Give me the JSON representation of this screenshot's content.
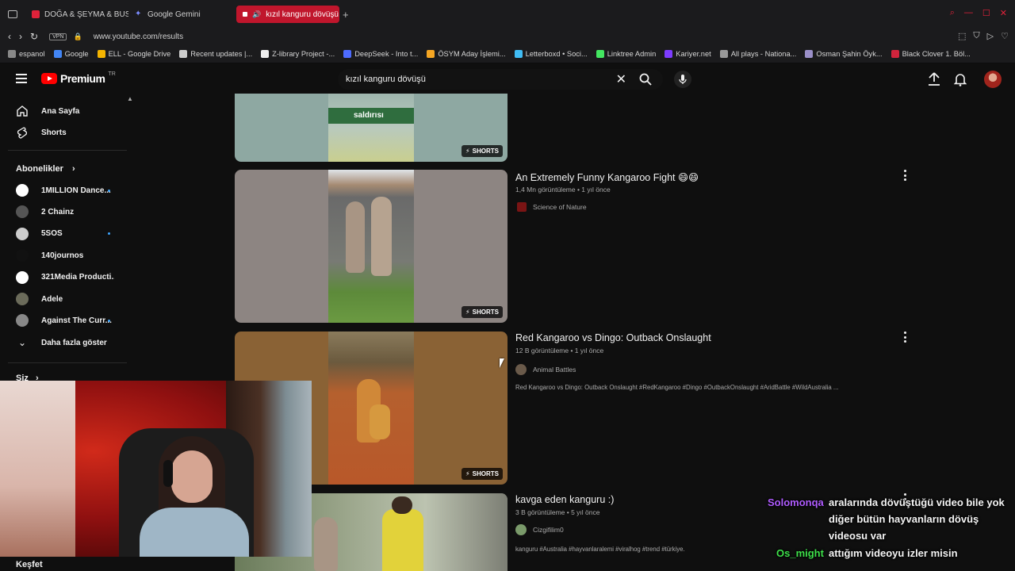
{
  "browser": {
    "tabs": [
      {
        "label": "DOĞA & ŞEYMA & BUSE &",
        "color": "#e0223a"
      },
      {
        "label": "Google Gemini",
        "color": "#7b8cff"
      },
      {
        "label": "kızıl kanguru dövüşü -",
        "color": "#ffffff",
        "active": true
      }
    ],
    "vpn_label": "VPN",
    "url": "www.youtube.com/results",
    "bookmarks": [
      {
        "label": "espanol",
        "color": "#888888"
      },
      {
        "label": "Google",
        "color": "#4285f4"
      },
      {
        "label": "ELL - Google Drive",
        "color": "#f4b400"
      },
      {
        "label": "Recent updates |...",
        "color": "#cccccc"
      },
      {
        "label": "Z-library Project -...",
        "color": "#eeeeee"
      },
      {
        "label": "DeepSeek - Into t...",
        "color": "#4d6bfe"
      },
      {
        "label": "ÖSYM Aday İşlemi...",
        "color": "#f5a623"
      },
      {
        "label": "Letterboxd • Soci...",
        "color": "#40bcf4"
      },
      {
        "label": "Linktree Admin",
        "color": "#43e660"
      },
      {
        "label": "Kariyer.net",
        "color": "#7d3cff"
      },
      {
        "label": "All plays - Nationa...",
        "color": "#999999"
      },
      {
        "label": "Osman Şahin Öyk...",
        "color": "#9a8fc8"
      },
      {
        "label": "Black Clover 1. Böl...",
        "color": "#d0243c"
      }
    ]
  },
  "youtube": {
    "logo_text": "Premium",
    "logo_region": "TR",
    "search_query": "kızıl kanguru dövüşü"
  },
  "sidebar": {
    "main_items": [
      {
        "label": "Ana Sayfa",
        "icon": "home-icon"
      },
      {
        "label": "Shorts",
        "icon": "shorts-icon"
      }
    ],
    "subscriptions_header": "Abonelikler",
    "subscriptions": [
      {
        "label": "1MILLION Dance...",
        "color": "#ffffff",
        "new": true
      },
      {
        "label": "2 Chainz",
        "color": "#555555",
        "new": false
      },
      {
        "label": "5SOS",
        "color": "#cccccc",
        "new": true
      },
      {
        "label": "140journos",
        "color": "#111111",
        "new": false
      },
      {
        "label": "321Media Producti...",
        "color": "#ffffff",
        "new": false
      },
      {
        "label": "Adele",
        "color": "#6b6b5a",
        "new": false
      },
      {
        "label": "Against The Curr...",
        "color": "#888888",
        "new": true
      }
    ],
    "show_more": "Daha fazla göster",
    "you_header": "Siz",
    "explore_header": "Keşfet"
  },
  "results": [
    {
      "title": "",
      "caption": "saldırısı",
      "badge": "SHORTS"
    },
    {
      "title": "An Extremely Funny Kangaroo Fight 😄😄",
      "meta": "1,4 Mn görüntüleme • 1 yıl önce",
      "channel": "Science of Nature",
      "channel_color": "#d02020",
      "badge": "SHORTS"
    },
    {
      "title": "Red Kangaroo vs Dingo: Outback Onslaught",
      "meta": "12 B görüntüleme • 1 yıl önce",
      "channel": "Animal Battles",
      "channel_color": "#6a5a4a",
      "description": "Red Kangaroo vs Dingo: Outback Onslaught #RedKangaroo #Dingo #OutbackOnslaught #AridBattle #WildAustralia ...",
      "badge": "SHORTS"
    },
    {
      "title": "kavga eden kanguru :)",
      "meta": "3 B görüntüleme • 5 yıl önce",
      "channel": "Cizgifilim0",
      "channel_color": "#7a9a6a",
      "description": "kanguru #Australia #hayvanlaralemi #viralhog #trend #türkiye."
    }
  ],
  "chat": [
    {
      "user": "Solomonqa",
      "user_color": "#b05cff",
      "lines": [
        "aralarında dövüştüğü video bile yok",
        "diğer bütün hayvanların dövüş",
        "videosu var"
      ]
    },
    {
      "user": "Os_might",
      "user_color": "#3ee04a",
      "lines": [
        "attığım videoyu izler misin"
      ]
    }
  ]
}
